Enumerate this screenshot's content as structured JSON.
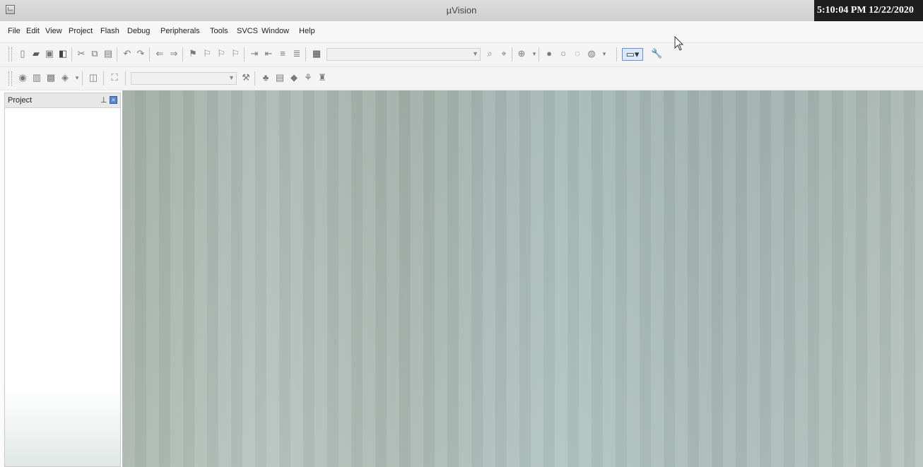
{
  "window": {
    "title": "µVision",
    "clock": "5:10:04 PM 12/22/2020",
    "app_icon": "uvision-app-icon"
  },
  "menu": {
    "items": [
      "File",
      "Edit",
      "View",
      "Project",
      "Flash",
      "Debug",
      "Peripherals",
      "Tools",
      "SVCS",
      "Window",
      "Help"
    ]
  },
  "toolbar_main": {
    "icons": [
      "new-file-icon",
      "open-file-icon",
      "save-icon",
      "save-all-icon",
      "cut-icon",
      "copy-icon",
      "paste-icon",
      "undo-icon",
      "redo-icon",
      "navigate-back-icon",
      "navigate-forward-icon",
      "bookmark-icon",
      "prev-bookmark-icon",
      "next-bookmark-icon",
      "clear-bookmarks-icon",
      "indent-icon",
      "unindent-icon",
      "comment-icon",
      "uncomment-icon",
      "find-in-files-icon",
      "find-icon",
      "incremental-find-icon",
      "zoom-icon",
      "debug-start-icon",
      "breakpoint-icon",
      "disable-breakpoint-icon",
      "breakpoint-kill-icon",
      "window-layout-icon",
      "configure-icon"
    ]
  },
  "toolbar_build": {
    "icons": [
      "translate-icon",
      "build-icon",
      "rebuild-icon",
      "batch-build-icon",
      "stop-build-icon",
      "download-icon",
      "target-options-icon",
      "file-extensions-icon",
      "manage-components-icon",
      "select-packs-icon",
      "device-database-icon"
    ]
  },
  "project_panel": {
    "title": "Project",
    "pin_icon": "pin-icon",
    "close_icon": "close-icon"
  },
  "colors": {
    "title_bar": "#d6d6d6",
    "clock_bg": "#1e1e1e",
    "workspace": "#aebab5"
  }
}
